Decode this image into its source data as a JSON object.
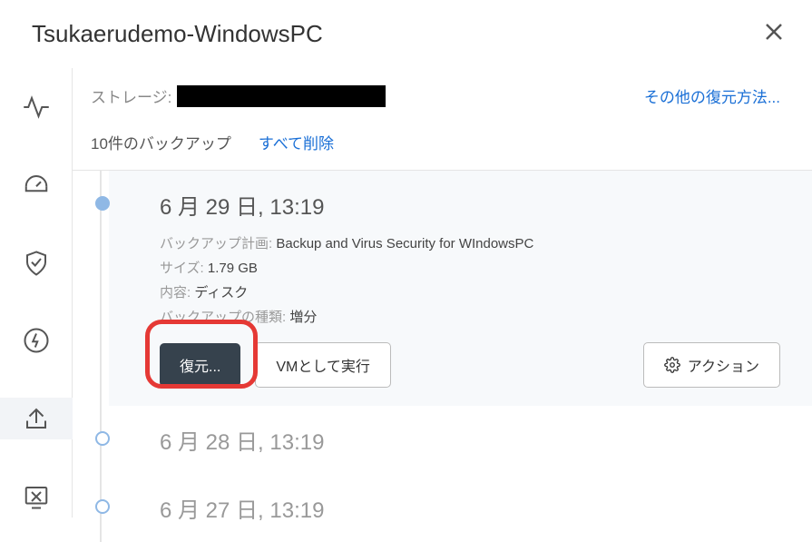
{
  "header": {
    "title": "Tsukaerudemo-WindowsPC"
  },
  "storage": {
    "label": "ストレージ:"
  },
  "links": {
    "other_restore": "その他の復元方法...",
    "delete_all": "すべて削除"
  },
  "backups_count": "10件のバックアップ",
  "backups": [
    {
      "date": "6 月 29 日, 13:19",
      "plan_label": "バックアップ計画:",
      "plan_value": "Backup and Virus Security for WIndowsPC",
      "size_label": "サイズ:",
      "size_value": "1.79 GB",
      "content_label": "内容:",
      "content_value": "ディスク",
      "type_label": "バックアップの種類:",
      "type_value": "増分"
    },
    {
      "date": "6 月 28 日, 13:19"
    },
    {
      "date": "6 月 27 日, 13:19"
    }
  ],
  "buttons": {
    "restore": "復元...",
    "run_as_vm": "VMとして実行",
    "action": "アクション"
  }
}
